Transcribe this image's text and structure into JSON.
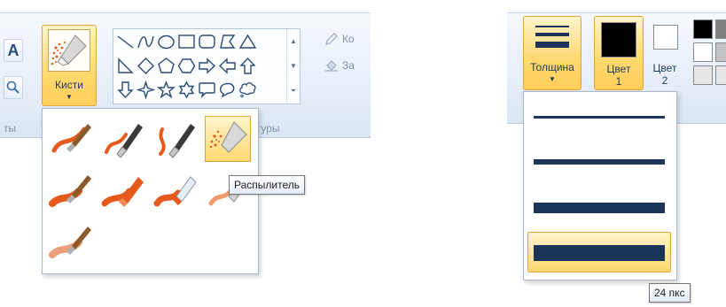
{
  "left_ribbon": {
    "brushes_label": "Кисти",
    "text_tool_glyph": "A",
    "magnifier_glyph": "🔍",
    "outline_label": "Ко",
    "fill_label": "За",
    "group_left_label": "ты",
    "shapes_group_label": "гуры",
    "shapes": [
      "line",
      "curve",
      "oval",
      "rectangle",
      "rounded-rectangle",
      "polygon",
      "triangle",
      "right-triangle",
      "diamond",
      "pentagon",
      "hexagon",
      "arrow-right",
      "arrow-left",
      "arrow-up",
      "arrow-down",
      "star-four",
      "star-five",
      "star-six",
      "callout-rounded-rectangle",
      "callout-oval",
      "callout-cloud"
    ]
  },
  "brush_menu": {
    "items": [
      "brush",
      "calligraphy-brush-1",
      "calligraphy-brush-2",
      "airbrush",
      "oil-brush",
      "crayon",
      "marker",
      "natural-pencil",
      "watercolor-brush"
    ],
    "selected_index": 3,
    "tooltip": "Распылитель"
  },
  "right_ribbon": {
    "width_label": "Толщина",
    "color1_label_line1": "Цвет",
    "color1_label_line2": "1",
    "color2_label_line1": "Цвет",
    "color2_label_line2": "2",
    "color1_value": "#000000",
    "color2_value": "#ffffff",
    "palette": [
      "#000000",
      "#7f7f7f",
      "#ffffff",
      "#c3c3c3",
      "#e6e6e6",
      "#e6e6e6"
    ]
  },
  "width_menu": {
    "options": [
      1,
      3,
      5,
      8
    ],
    "selected_index": 3,
    "tooltip": "24 пкс"
  },
  "colors": {
    "accent_border": "#e3a33b",
    "accent_fill": "#ffd86f",
    "line_color": "#1b3457",
    "brush_orange": "#e55a1c"
  }
}
